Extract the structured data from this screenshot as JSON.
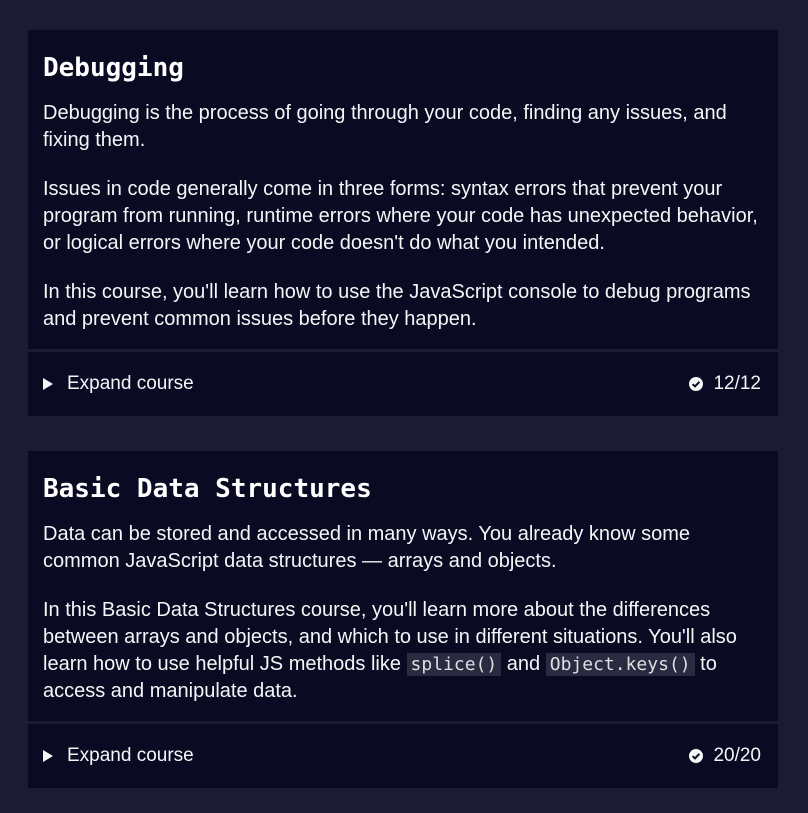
{
  "courses": [
    {
      "title": "Debugging",
      "paragraphs": [
        "Debugging is the process of going through your code, finding any issues, and fixing them.",
        "Issues in code generally come in three forms: syntax errors that prevent your program from running, runtime errors where your code has unexpected behavior, or logical errors where your code doesn't do what you intended.",
        "In this course, you'll learn how to use the JavaScript console to debug programs and prevent common issues before they happen."
      ],
      "expand_label": "Expand course",
      "progress": "12/12",
      "progress_fraction": 1.0
    },
    {
      "title": "Basic Data Structures",
      "paragraphs": [
        "Data can be stored and accessed in many ways. You already know some common JavaScript data structures — arrays and objects."
      ],
      "p2": {
        "before": "In this Basic Data Structures course, you'll learn more about the differences between arrays and objects, and which to use in different situations. You'll also learn how to use helpful JS methods like ",
        "code1": "splice()",
        "middle": " and ",
        "code2": "Object.keys()",
        "after": " to access and manipulate data."
      },
      "expand_label": "Expand course",
      "progress": "20/20",
      "progress_fraction": 1.0
    }
  ],
  "icons": {
    "expand": "caret-right-icon",
    "complete": "check-circle-icon"
  },
  "colors": {
    "page_bg": "#1b1b32",
    "card_bg": "#0a0a23",
    "text": "#f5f6f7",
    "code_bg": "#2a2a40"
  }
}
